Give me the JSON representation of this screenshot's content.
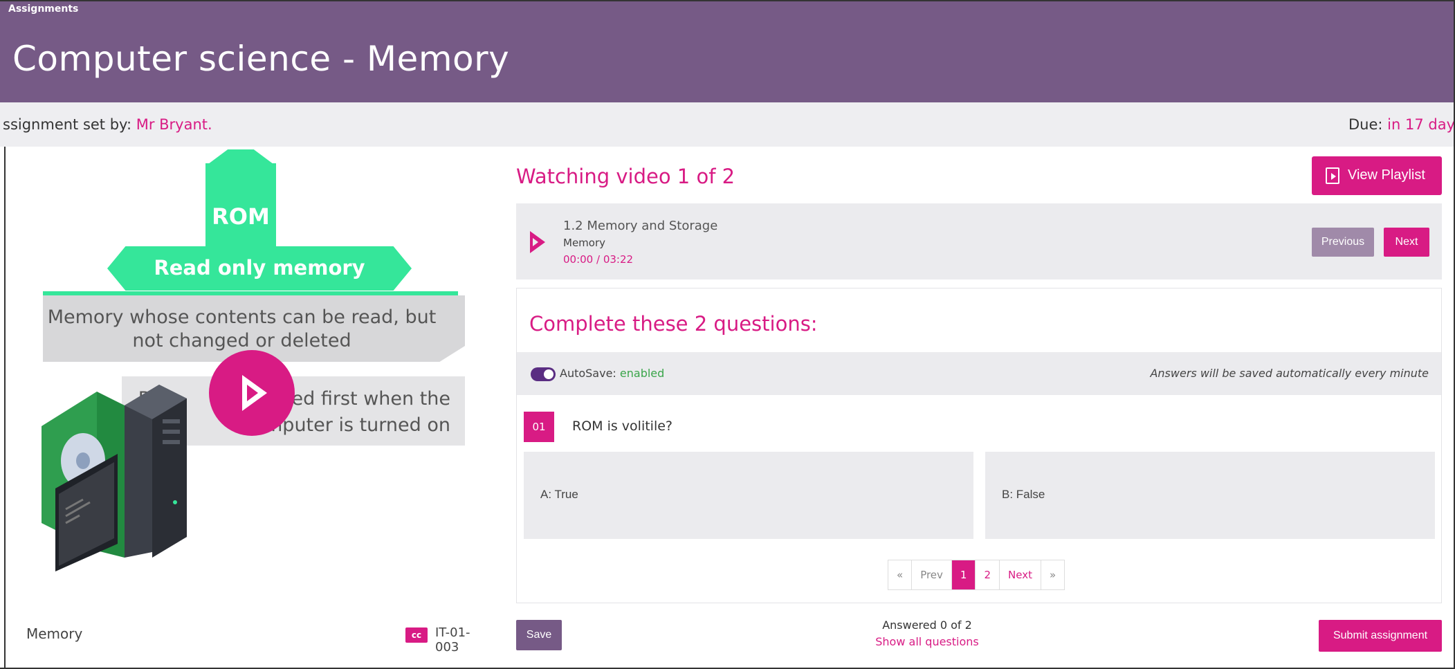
{
  "breadcrumb": "Assignments",
  "page_title": "Computer science - Memory",
  "meta": {
    "set_by_label": "ssignment set by: ",
    "teacher": "Mr Bryant.",
    "due_label": "Due: ",
    "due_value": "in 17 day"
  },
  "video": {
    "slide": {
      "rom_title": "ROM",
      "rom_subtitle": "Read only memory",
      "definition": "Memory whose contents can be read, but not changed or deleted",
      "fact_prefix": "R",
      "fact_rest": "ccessed first when the computer is turned on"
    },
    "name": "Memory",
    "cc_label": "cc",
    "code": "IT-01-003"
  },
  "watching": "Watching video 1 of 2",
  "view_playlist": "View Playlist",
  "now_playing": {
    "title": "1.2 Memory and Storage",
    "subtitle": "Memory",
    "time": "00:00 / 03:22",
    "previous": "Previous",
    "next": "Next"
  },
  "questions": {
    "heading": "Complete these 2 questions:",
    "autosave_label": "AutoSave: ",
    "autosave_status": "enabled",
    "autosave_note": "Answers will be saved automatically every minute",
    "number": "01",
    "text": "ROM is volitile?",
    "options": [
      {
        "label": "A:  True"
      },
      {
        "label": "B:  False"
      }
    ],
    "pager": {
      "first": "«",
      "prev": "Prev",
      "pages": [
        "1",
        "2"
      ],
      "next": "Next",
      "last": "»"
    }
  },
  "footer": {
    "save": "Save",
    "answered": "Answered 0 of 2",
    "show_all": "Show all questions",
    "submit": "Submit assignment"
  },
  "colors": {
    "header": "#765a86",
    "accent": "#d81b84",
    "slide_green": "#35e69a",
    "toggle": "#5a2d82"
  }
}
